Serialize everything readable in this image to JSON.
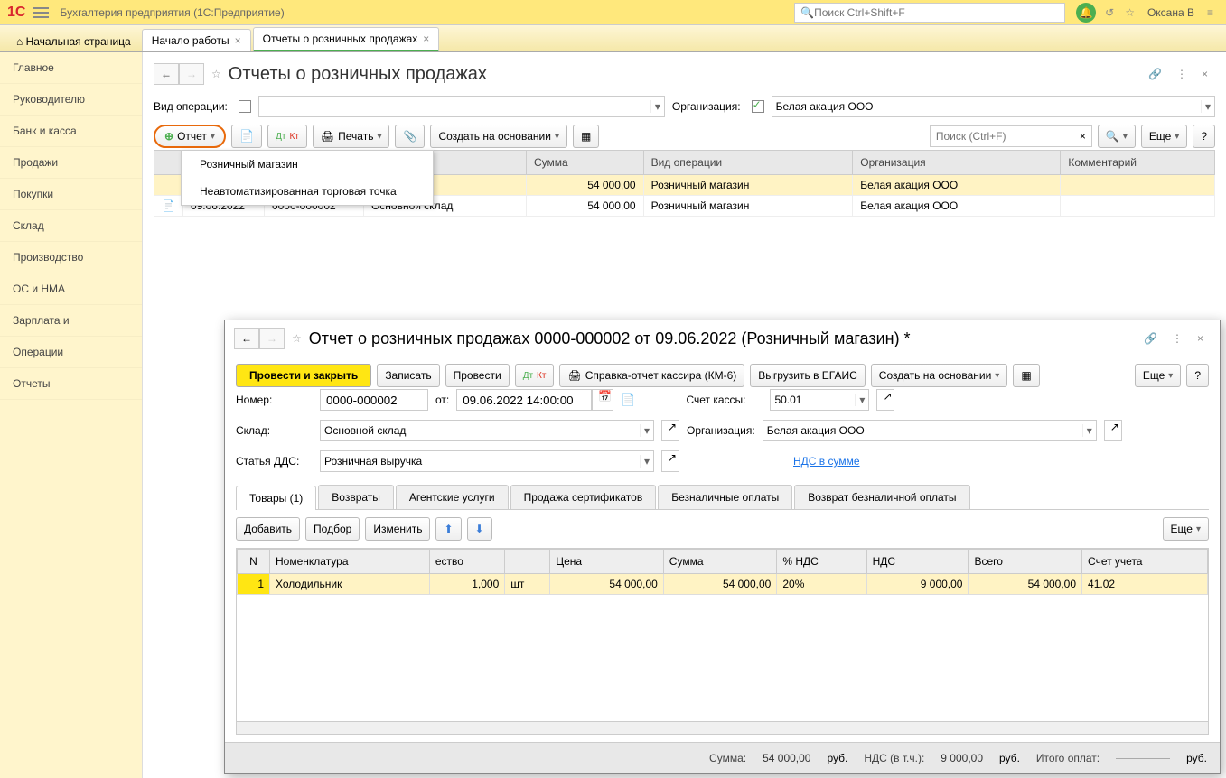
{
  "app": {
    "title": "Бухгалтерия предприятия  (1С:Предприятие)",
    "search_placeholder": "Поиск Ctrl+Shift+F",
    "user": "Оксана В"
  },
  "tabs": {
    "home": "Начальная страница",
    "t1": "Начало работы",
    "t2": "Отчеты о розничных продажах"
  },
  "sidebar": [
    "Главное",
    "Руководителю",
    "Банк и касса",
    "Продажи",
    "Покупки",
    "Склад",
    "Производство",
    "ОС и НМА",
    "Зарплата и",
    "Операции",
    "Отчеты"
  ],
  "list": {
    "page_title": "Отчеты о розничных продажах",
    "vid_op_label": "Вид операции:",
    "org_label": "Организация:",
    "org_value": "Белая акация ООО",
    "btn_report": "Отчет",
    "btn_print": "Печать",
    "btn_create_based": "Создать на основании",
    "search_placeholder": "Поиск (Ctrl+F)",
    "btn_more": "Еще",
    "menu": {
      "retail": "Розничный магазин",
      "manual": "Неавтоматизированная торговая точка"
    },
    "cols": {
      "sum": "Сумма",
      "vid": "Вид операции",
      "org": "Организация",
      "comment": "Комментарий"
    },
    "rows": [
      {
        "date": "",
        "num": "",
        "sklad": "лад",
        "sum": "54 000,00",
        "vid": "Розничный магазин",
        "org": "Белая акация ООО"
      },
      {
        "date": "09.06.2022",
        "num": "0000-000002",
        "sklad": "Основной склад",
        "sum": "54 000,00",
        "vid": "Розничный магазин",
        "org": "Белая акация ООО"
      }
    ]
  },
  "doc": {
    "title": "Отчет о розничных продажах 0000-000002 от 09.06.2022 (Розничный магазин) *",
    "btn_post_close": "Провести и закрыть",
    "btn_write": "Записать",
    "btn_post": "Провести",
    "btn_km6": "Справка-отчет кассира (КМ-6)",
    "btn_egais": "Выгрузить в ЕГАИС",
    "btn_create_based": "Создать на основании",
    "btn_more": "Еще",
    "labels": {
      "number": "Номер:",
      "from": "от:",
      "account": "Счет кассы:",
      "sklad": "Склад:",
      "org": "Организация:",
      "dds": "Статья ДДС:",
      "nds_link": "НДС в сумме"
    },
    "values": {
      "number": "0000-000002",
      "date": "09.06.2022 14:00:00",
      "account": "50.01",
      "sklad": "Основной склад",
      "org": "Белая акация ООО",
      "dds": "Розничная выручка"
    },
    "tabs": [
      "Товары (1)",
      "Возвраты",
      "Агентские услуги",
      "Продажа сертификатов",
      "Безналичные оплаты",
      "Возврат безналичной оплаты"
    ],
    "item_btns": {
      "add": "Добавить",
      "pick": "Подбор",
      "edit": "Изменить",
      "more": "Еще"
    },
    "item_cols": {
      "n": "N",
      "nomen": "Номенклатура",
      "qty": "ество",
      "price": "Цена",
      "sum": "Сумма",
      "ndsp": "% НДС",
      "nds": "НДС",
      "total": "Всего",
      "acct": "Счет учета"
    },
    "item_row": {
      "n": "1",
      "nomen": "Холодильник",
      "qty": "1,000",
      "unit": "шт",
      "price": "54 000,00",
      "sum": "54 000,00",
      "ndsp": "20%",
      "nds": "9 000,00",
      "total": "54 000,00",
      "acct": "41.02"
    },
    "footer": {
      "sum_label": "Сумма:",
      "sum": "54 000,00",
      "rub": "руб.",
      "nds_label": "НДС (в т.ч.):",
      "nds": "9 000,00",
      "total_label": "Итого оплат:",
      "total_rub": "руб."
    }
  }
}
